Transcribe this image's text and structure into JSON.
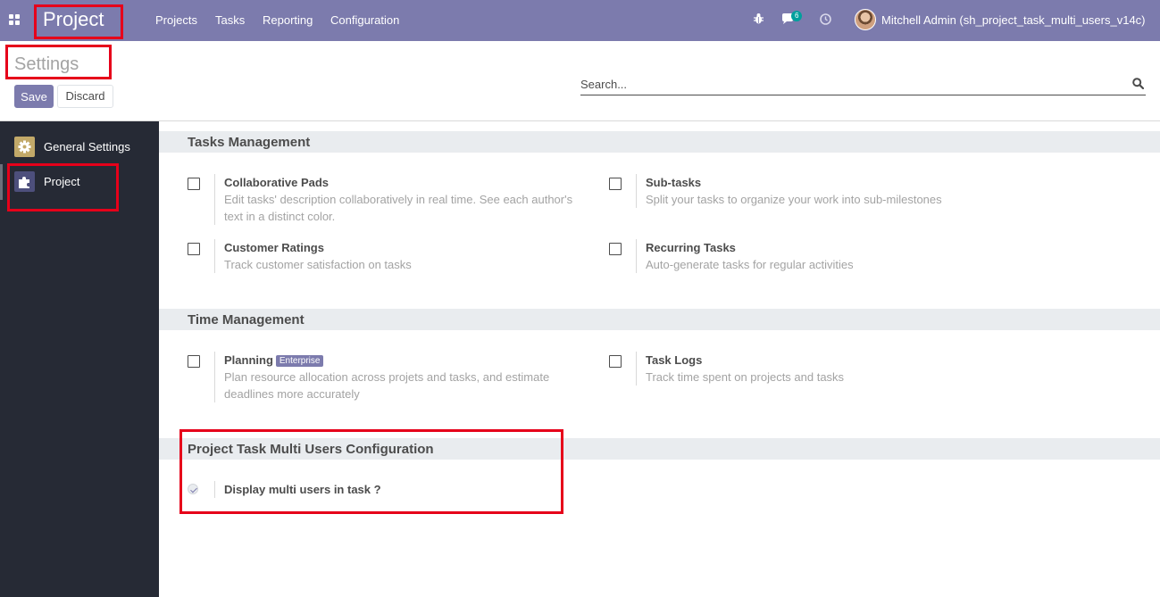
{
  "navbar": {
    "app_name": "Project",
    "menu": [
      "Projects",
      "Tasks",
      "Reporting",
      "Configuration"
    ],
    "icons": {
      "apps": "apps-grid-icon",
      "debug": "bug-icon",
      "messages": "chat-icon",
      "activities": "clock-icon"
    },
    "message_count": "6",
    "user_name": "Mitchell Admin (sh_project_task_multi_users_v14c)"
  },
  "control_panel": {
    "title": "Settings",
    "search_placeholder": "Search...",
    "save_label": "Save",
    "discard_label": "Discard"
  },
  "sidebar": {
    "items": [
      {
        "label": "General Settings",
        "icon": "gear-icon",
        "color": "#c2a969"
      },
      {
        "label": "Project",
        "icon": "puzzle-icon",
        "color": "#4d4f7c"
      }
    ]
  },
  "sections": [
    {
      "title": "Tasks Management",
      "settings": [
        {
          "title": "Collaborative Pads",
          "description": "Edit tasks' description collaboratively in real time. See each author's text in a distinct color.",
          "checked": false
        },
        {
          "title": "Sub-tasks",
          "description": "Split your tasks to organize your work into sub-milestones",
          "checked": false
        },
        {
          "title": "Customer Ratings",
          "description": "Track customer satisfaction on tasks",
          "checked": false
        },
        {
          "title": "Recurring Tasks",
          "description": "Auto-generate tasks for regular activities",
          "checked": false
        }
      ]
    },
    {
      "title": "Time Management",
      "settings": [
        {
          "title": "Planning",
          "badge": "Enterprise",
          "description": "Plan resource allocation across projets and tasks, and estimate deadlines more accurately",
          "checked": false
        },
        {
          "title": "Task Logs",
          "description": "Track time spent on projects and tasks",
          "checked": false
        }
      ]
    },
    {
      "title": "Project Task Multi Users Configuration",
      "settings": [
        {
          "title": "Display multi users in task ?",
          "checked": true
        }
      ]
    }
  ],
  "colors": {
    "brand": "#7c7bad",
    "sidebar": "#262a35",
    "highlight": "#e6001a"
  }
}
